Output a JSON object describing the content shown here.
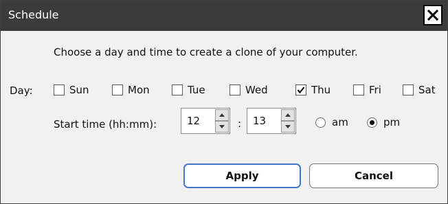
{
  "window": {
    "title": "Schedule",
    "close_icon": "close-icon"
  },
  "instruction": "Choose a day and time to create a clone of your computer.",
  "day": {
    "label": "Day:",
    "options": [
      {
        "label": "Sun",
        "checked": false
      },
      {
        "label": "Mon",
        "checked": false
      },
      {
        "label": "Tue",
        "checked": false
      },
      {
        "label": "Wed",
        "checked": false
      },
      {
        "label": "Thu",
        "checked": true
      },
      {
        "label": "Fri",
        "checked": false
      },
      {
        "label": "Sat",
        "checked": false
      }
    ]
  },
  "start_time": {
    "label": "Start time (hh:mm):",
    "hours": "12",
    "separator": ":",
    "minutes": "13",
    "period_options": [
      {
        "label": "am",
        "selected": false
      },
      {
        "label": "pm",
        "selected": true
      }
    ]
  },
  "buttons": {
    "apply": "Apply",
    "cancel": "Cancel"
  },
  "colors": {
    "titlebar": "#3b3b3b",
    "apply_border": "#3f78c9",
    "background": "#f1f1f1"
  }
}
